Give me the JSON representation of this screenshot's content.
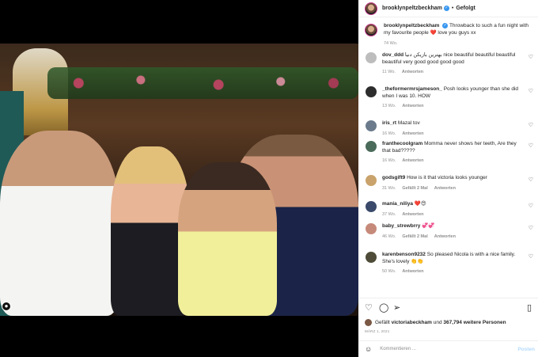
{
  "header": {
    "username": "brooklynpeltzbeckham",
    "separator": "•",
    "follow_state": "Gefolgt"
  },
  "caption": {
    "username": "brooklynpeltzbeckham",
    "text": "Throwback to such a fun night with my favourite people ❤️ love you guys xx",
    "time": "74 Wo."
  },
  "comments": [
    {
      "username": "dov_ddd",
      "text": "بهترین بازیکن دنیا nice beautiful beautiful beautiful beautiful very good good good good",
      "time": "11 Wo.",
      "reply": "Antworten",
      "avatar_color": "#bdbdbd"
    },
    {
      "username": "_theformermrsjameson_",
      "text": "Posh looks younger than she did when I was 10. HOW",
      "time": "13 Wo.",
      "reply": "Antworten",
      "avatar_color": "#2d2d2d"
    },
    {
      "username": "iris_rt",
      "text": "Mazal tov",
      "time": "16 Wo.",
      "reply": "Antworten",
      "avatar_color": "#6b7b8c"
    },
    {
      "username": "franthecoolgram",
      "text": "Momma never shows her teeth, Are they that bad?????",
      "time": "16 Wo.",
      "reply": "Antworten",
      "avatar_color": "#4a6b5a"
    },
    {
      "username": "godsgift9",
      "text": "How is it that victoria looks younger",
      "time": "31 Wo.",
      "likes": "Gefällt 2 Mal",
      "reply": "Antworten",
      "avatar_color": "#c9a36b"
    },
    {
      "username": "mania_niliya",
      "text": "❤️😍",
      "time": "37 Wo.",
      "reply": "Antworten",
      "avatar_color": "#3b4a6b"
    },
    {
      "username": "baby_strewbrry",
      "text": "💞💞",
      "time": "46 Wo.",
      "likes": "Gefällt 2 Mal",
      "reply": "Antworten",
      "avatar_color": "#c68a7a"
    },
    {
      "username": "karenbenson9232",
      "text": "So pleased Nicola is with a nice family. She's lovely 👏👏",
      "time": "50 Wo.",
      "reply": "Antworten",
      "avatar_color": "#4e4b38"
    }
  ],
  "likes": {
    "prefix": "Gefällt",
    "user": "victoriabeckham",
    "joiner": "und",
    "count": "367,794 weitere Personen"
  },
  "date": "MÄRZ 1, 2021",
  "add_comment": {
    "placeholder": "Kommentieren ...",
    "post_label": "Posten"
  },
  "icons": {
    "like": "heart-icon",
    "comment": "comment-icon",
    "share": "share-icon",
    "save": "bookmark-icon",
    "emoji": "emoji-icon"
  },
  "colors": {
    "verified": "#3897f0",
    "post_disabled": "#b3dbff",
    "text": "#262626",
    "muted": "#8e8e8e"
  }
}
